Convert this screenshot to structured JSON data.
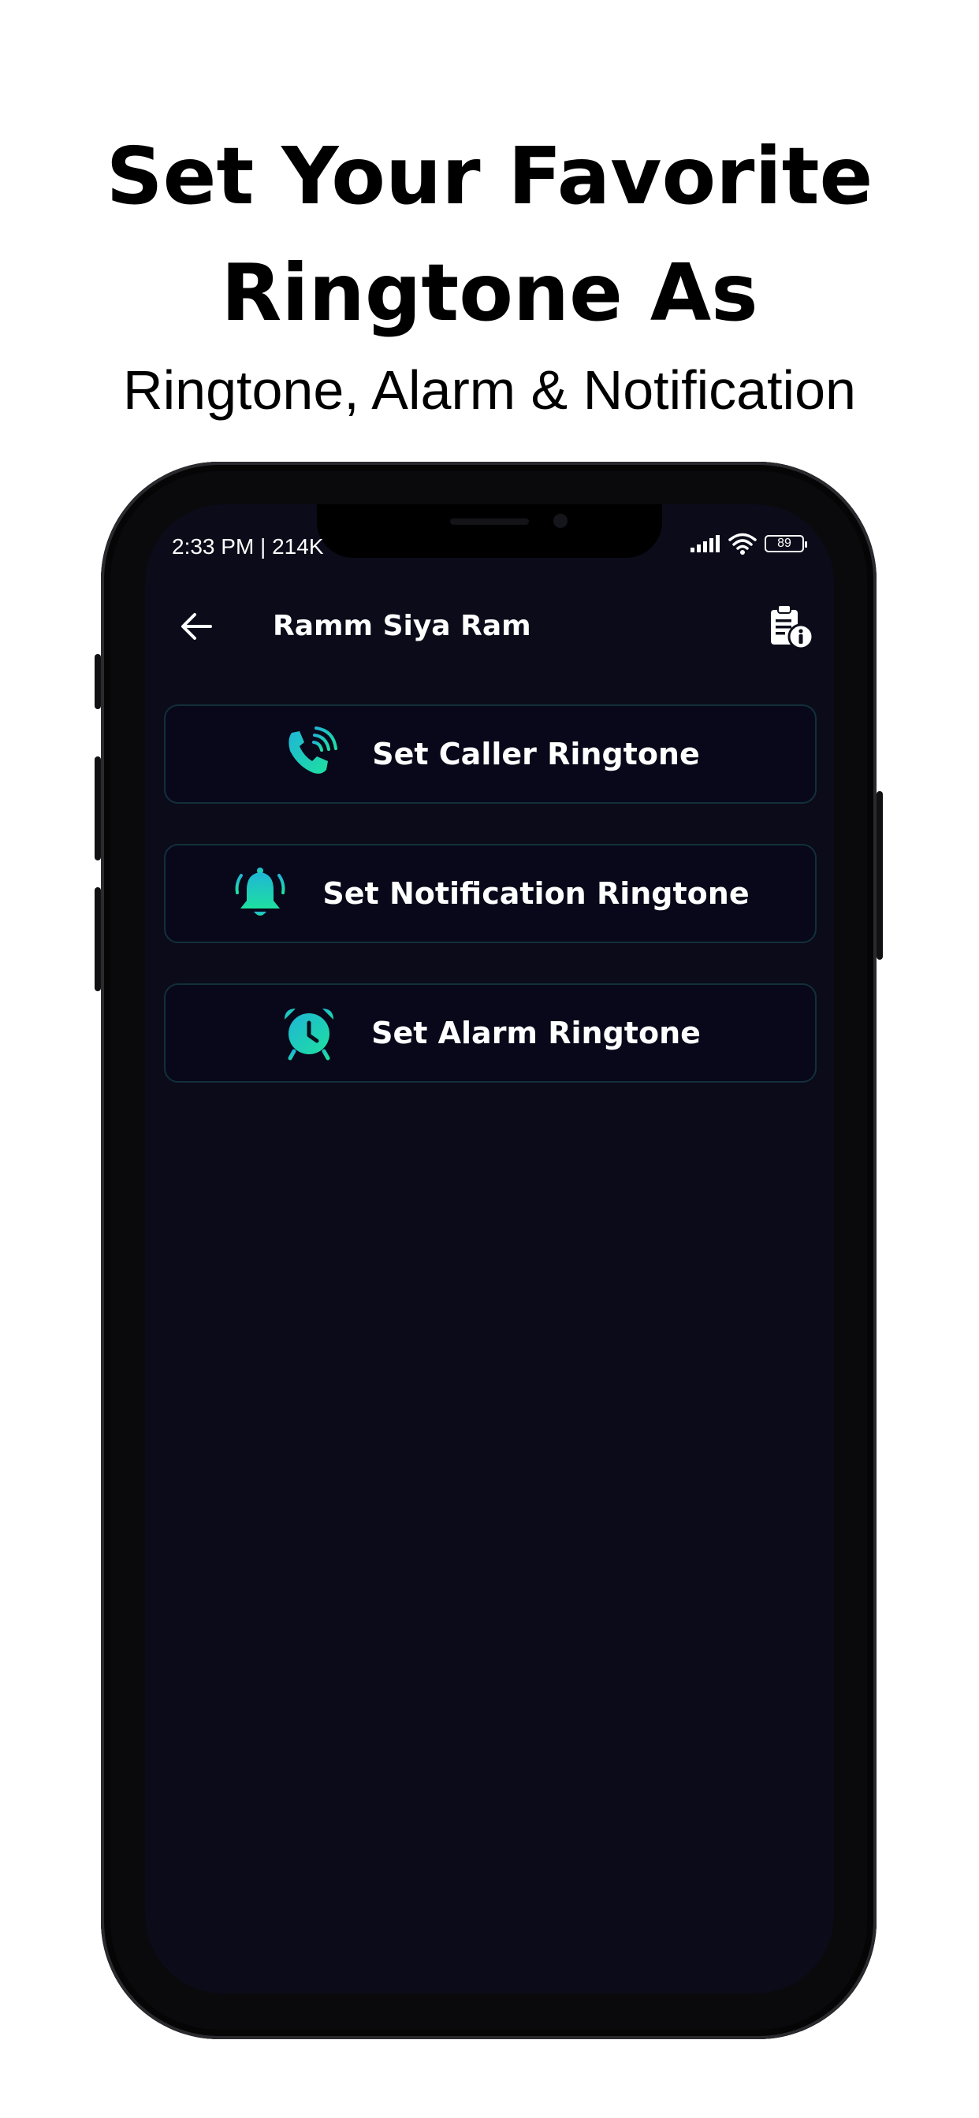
{
  "promo": {
    "headline_line1": "Set Your Favorite",
    "headline_line2": "Ringtone As",
    "subheadline": "Ringtone, Alarm & Notification"
  },
  "status_bar": {
    "time_text": "2:33 PM | 214K",
    "battery": "89",
    "icons": [
      "signal-icon",
      "wifi-icon",
      "battery-icon"
    ]
  },
  "app_bar": {
    "back_icon": "arrow-left-icon",
    "title": "Ramm Siya Ram",
    "info_icon": "clipboard-info-icon"
  },
  "options": [
    {
      "label": "Set Caller Ringtone",
      "icon": "phone-ringing-icon"
    },
    {
      "label": "Set Notification Ringtone",
      "icon": "bell-icon"
    },
    {
      "label": "Set Alarm Ringtone",
      "icon": "alarm-clock-icon"
    }
  ],
  "colors": {
    "screen_bg": "#0b0b1a",
    "card_bg": "#08081a",
    "card_border": "#12303a",
    "accent_start": "#1fb6d6",
    "accent_end": "#1ee0a0",
    "text": "#ffffff"
  }
}
